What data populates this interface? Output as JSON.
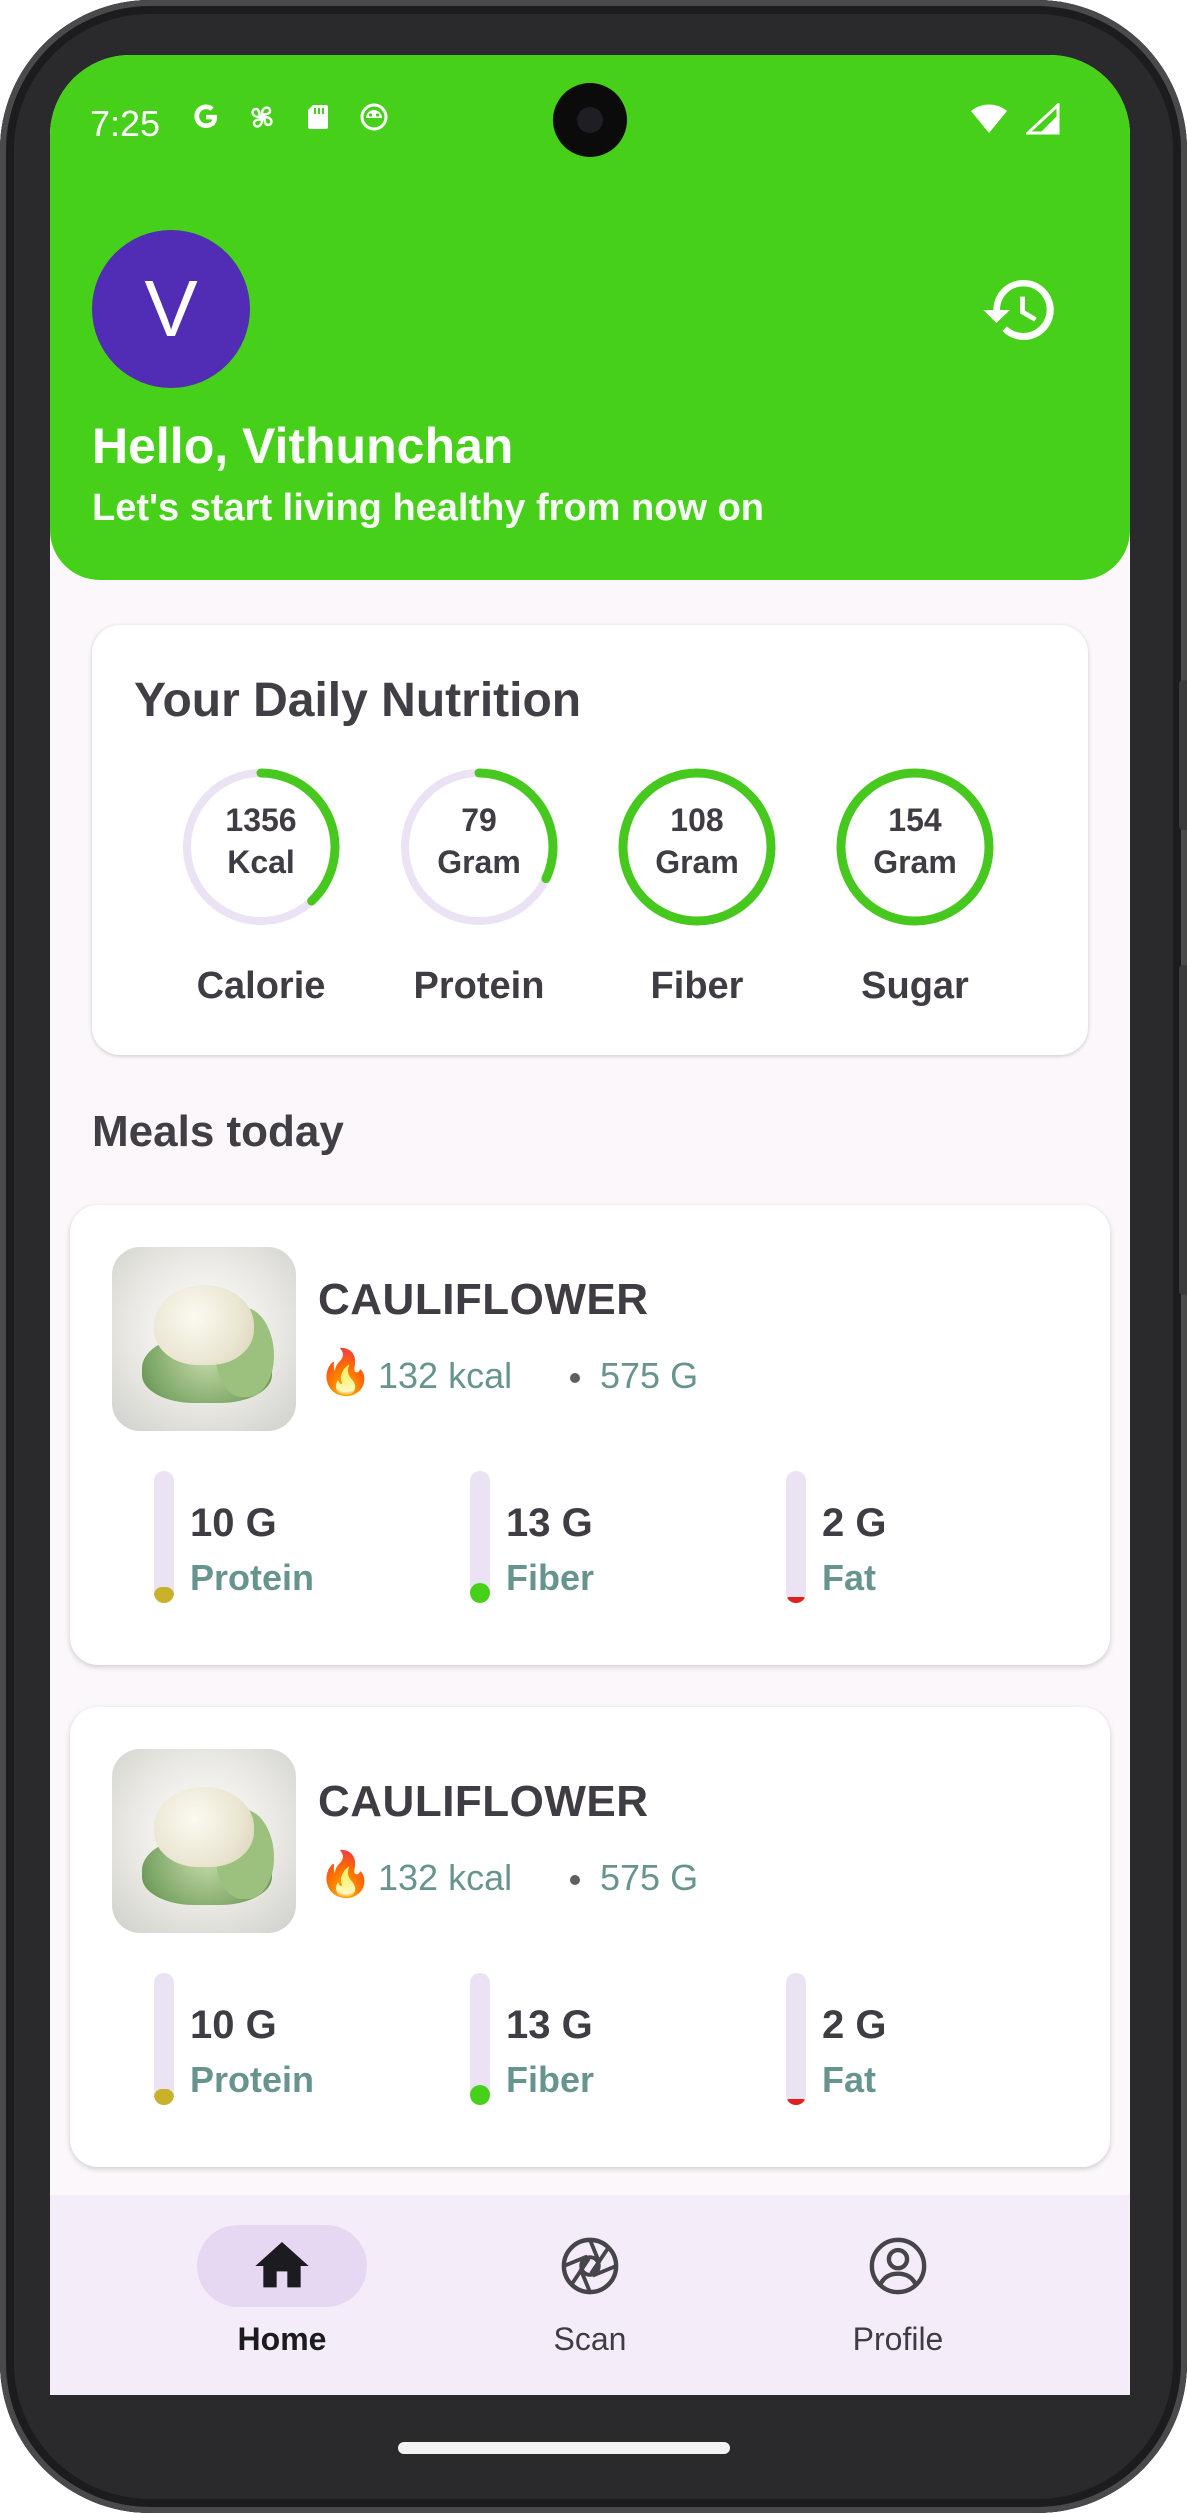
{
  "status_bar": {
    "time": "7:25",
    "left_icons": [
      "google-icon",
      "pinwheel-icon",
      "sd-card-icon",
      "android-debug-icon"
    ],
    "right_icons": [
      "wifi-icon",
      "signal-icon"
    ]
  },
  "header": {
    "avatar_initial": "V",
    "greeting": "Hello, Vithunchan",
    "tagline": "Let's start living healthy from now on",
    "history_icon": "history-icon",
    "background_color": "#47d01a",
    "avatar_color": "#512cb4"
  },
  "daily_nutrition": {
    "title": "Your Daily Nutrition",
    "items": [
      {
        "value": "1356",
        "unit": "Kcal",
        "label": "Calorie",
        "progress": 0.38
      },
      {
        "value": "79",
        "unit": "Gram",
        "label": "Protein",
        "progress": 0.32
      },
      {
        "value": "108",
        "unit": "Gram",
        "label": "Fiber",
        "progress": 1.0
      },
      {
        "value": "154",
        "unit": "Gram",
        "label": "Sugar",
        "progress": 1.0
      }
    ],
    "ring_color": "#47c81f",
    "track_color": "#ebe2f4"
  },
  "meals": {
    "title": "Meals today",
    "items": [
      {
        "name": "CAULIFLOWER",
        "kcal": "132 kcal",
        "weight": "575 G",
        "macros": [
          {
            "value": "10 G",
            "label": "Protein",
            "fill": 0.12,
            "color": "#c8b22a"
          },
          {
            "value": "13 G",
            "label": "Fiber",
            "fill": 0.15,
            "color": "#47d01a"
          },
          {
            "value": "2 G",
            "label": "Fat",
            "fill": 0.03,
            "color": "#e0201a"
          }
        ]
      },
      {
        "name": "CAULIFLOWER",
        "kcal": "132 kcal",
        "weight": "575 G",
        "macros": [
          {
            "value": "10 G",
            "label": "Protein",
            "fill": 0.12,
            "color": "#c8b22a"
          },
          {
            "value": "13 G",
            "label": "Fiber",
            "fill": 0.15,
            "color": "#47d01a"
          },
          {
            "value": "2 G",
            "label": "Fat",
            "fill": 0.03,
            "color": "#e0201a"
          }
        ]
      }
    ]
  },
  "bottom_nav": {
    "items": [
      {
        "label": "Home",
        "icon": "home-icon",
        "active": true
      },
      {
        "label": "Scan",
        "icon": "camera-aperture-icon",
        "active": false
      },
      {
        "label": "Profile",
        "icon": "account-circle-icon",
        "active": false
      }
    ]
  }
}
